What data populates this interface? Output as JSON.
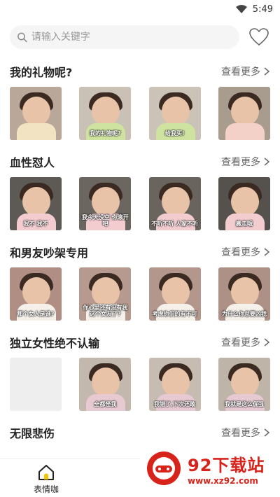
{
  "status": {
    "time": "5:49"
  },
  "search": {
    "placeholder": "请输入关键字"
  },
  "sections": [
    {
      "title": "我的礼物呢?",
      "more": "查看更多",
      "items": [
        {
          "caption": ""
        },
        {
          "caption": "我的礼物呢?"
        },
        {
          "caption": "给我买!"
        },
        {
          "caption": ""
        }
      ]
    },
    {
      "title": "血性怼人",
      "more": "查看更多",
      "items": [
        {
          "caption": "我不 我不"
        },
        {
          "caption": "我今天没空 你滚开吧"
        },
        {
          "caption": "不听不听 人家不听"
        },
        {
          "caption": "搬走哦"
        }
      ]
    },
    {
      "title": "和男友吵架专用",
      "more": "查看更多",
      "items": [
        {
          "caption": "那个女人是谁?"
        },
        {
          "caption": "你心里还有没有我这个女友了?"
        },
        {
          "caption": "考虑你们的有不可"
        },
        {
          "caption": "为什么你总要凶我"
        }
      ]
    },
    {
      "title": "独立女性绝不认输",
      "more": "查看更多",
      "items": [
        {
          "caption": ""
        },
        {
          "caption": "全都怪我"
        },
        {
          "caption": "我错了,下次还敢"
        },
        {
          "caption": "我就是这么倔强"
        }
      ]
    },
    {
      "title": "无限悲伤",
      "more": "查看更多",
      "items": []
    }
  ],
  "nav": {
    "home_label": "表情咖"
  },
  "watermark": {
    "brand": "92下载站",
    "url": "www.xz92.com"
  },
  "colors": {
    "accent_yellow": "#f5c400",
    "watermark_red": "#d8231b"
  }
}
